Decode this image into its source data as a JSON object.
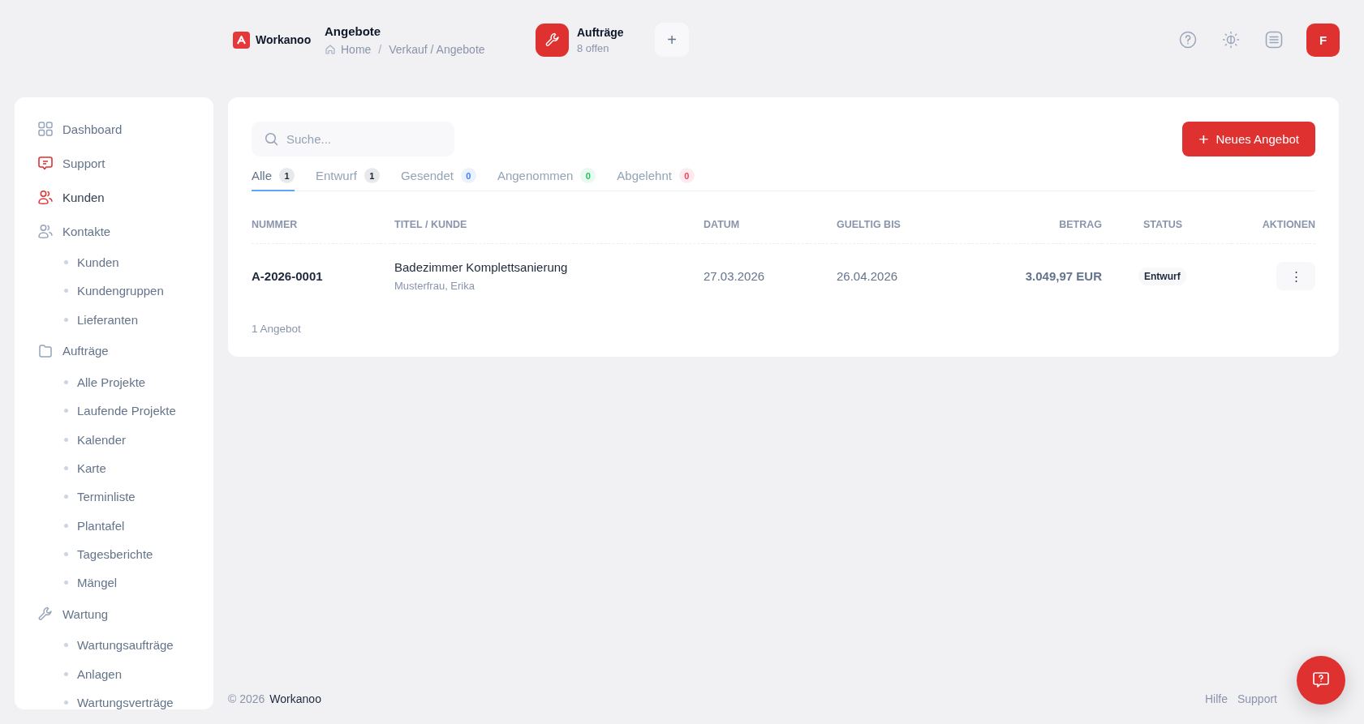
{
  "brand": {
    "name": "Workanoo"
  },
  "page": {
    "title": "Angebote",
    "breadcrumb": [
      {
        "kind": "link",
        "text": "Home"
      },
      {
        "kind": "separator",
        "text": "/"
      },
      {
        "kind": "link",
        "text": "Verkauf / Angebote"
      }
    ]
  },
  "orders_chip": {
    "title": "Aufträge",
    "subtitle": "8 offen"
  },
  "add_button": {
    "label": "+"
  },
  "user": {
    "initial": "F"
  },
  "sidebar": {
    "items": [
      {
        "label": "Dashboard",
        "kind": "grid",
        "selected": false
      },
      {
        "label": "Support",
        "kind": "chat",
        "selected": false
      },
      {
        "label": "Kunden",
        "kind": "users",
        "selected": true
      },
      {
        "label": "Kontakte",
        "kind": "users",
        "selected": false,
        "children": [
          {
            "label": "Kunden"
          },
          {
            "label": "Kundengruppen"
          },
          {
            "label": "Lieferanten"
          }
        ]
      },
      {
        "label": "Aufträge",
        "kind": "folder",
        "selected": false,
        "children": [
          {
            "label": "Alle Projekte"
          },
          {
            "label": "Laufende Projekte"
          },
          {
            "label": "Kalender"
          },
          {
            "label": "Karte"
          },
          {
            "label": "Terminliste"
          },
          {
            "label": "Plantafel"
          },
          {
            "label": "Tagesberichte"
          },
          {
            "label": "Mängel"
          }
        ]
      },
      {
        "label": "Wartung",
        "kind": "wrench",
        "selected": false,
        "children": [
          {
            "label": "Wartungsaufträge"
          },
          {
            "label": "Anlagen"
          },
          {
            "label": "Wartungsverträge"
          }
        ]
      }
    ]
  },
  "search": {
    "placeholder": "Suche..."
  },
  "new_button": {
    "label": "+",
    "text": "Neues Angebot"
  },
  "tabs": [
    {
      "label": "Alle",
      "count": "1",
      "selected": true,
      "color": "#1e293b"
    },
    {
      "label": "Entwurf",
      "count": "1",
      "selected": false,
      "color": "#1e293b"
    },
    {
      "label": "Gesendet",
      "count": "0",
      "selected": false,
      "color": "#3b82f6"
    },
    {
      "label": "Angenommen",
      "count": "0",
      "selected": false,
      "color": "#22c55e"
    },
    {
      "label": "Abgelehnt",
      "count": "0",
      "selected": false,
      "color": "#f43f5e"
    }
  ],
  "table": {
    "columns": [
      "NUMMER",
      "TITEL / KUNDE",
      "DATUM",
      "GUELTIG BIS",
      "BETRAG",
      "STATUS",
      "AKTIONEN"
    ],
    "rows": [
      {
        "nummer": "A-2026-0001",
        "titel": "Badezimmer Komplettsanierung",
        "kunde": "Musterfrau, Erika",
        "datum": "27.03.2026",
        "gueltig_bis": "26.04.2026",
        "betrag": "3.049,97 EUR",
        "status": "Entwurf",
        "actions": "⋮"
      }
    ]
  },
  "count_label": "1 Angebot",
  "footer": {
    "copyright": "© 2026",
    "brand": "Workanoo",
    "links": [
      "Hilfe",
      "Support"
    ]
  }
}
